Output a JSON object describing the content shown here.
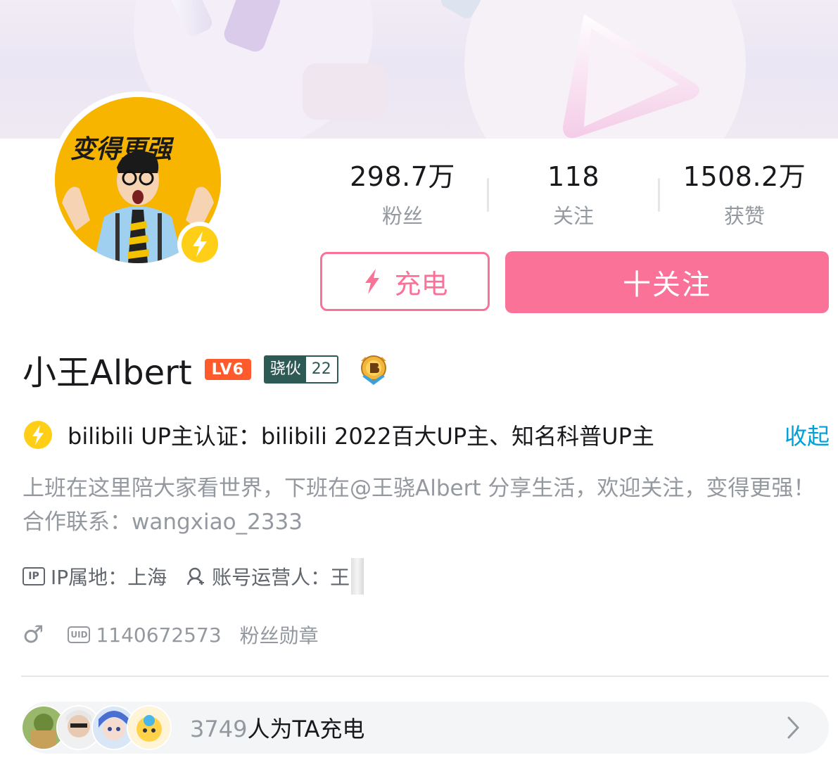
{
  "stats": [
    {
      "value": "298.7万",
      "label": "粉丝"
    },
    {
      "value": "118",
      "label": "关注"
    },
    {
      "value": "1508.2万",
      "label": "获赞"
    }
  ],
  "actions": {
    "charge_label": "充电",
    "follow_label": "十关注"
  },
  "profile": {
    "avatar_caption": "变得更强",
    "username": "小王Albert",
    "level_badge": "LV6",
    "medal_name": "骁伙",
    "medal_level": "22"
  },
  "verification": {
    "text": "bilibili UP主认证：bilibili 2022百大UP主、知名科普UP主",
    "collapse_label": "收起"
  },
  "bio": "上班在这里陪大家看世界，下班在@王骁Albert 分享生活，欢迎关注，变得更强！合作联系：wangxiao_2333",
  "meta": {
    "ip_icon_text": "IP",
    "ip_location": "IP属地：上海",
    "operator": "账号运营人：王"
  },
  "meta2": {
    "gender": "♂",
    "uid_icon_text": "UID",
    "uid": "1140672573",
    "fans_medal_link": "粉丝勋章"
  },
  "charge": {
    "count": "3749",
    "text": "人为TA充电"
  },
  "colors": {
    "accent_pink": "#fb7299",
    "link_blue": "#00a1d6",
    "verify_yellow": "#ffce16",
    "level_orange": "#ff5a2b",
    "medal_green": "#2e5a55"
  }
}
